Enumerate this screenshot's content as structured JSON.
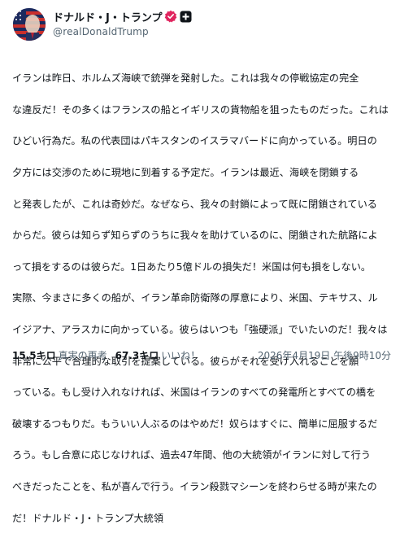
{
  "author": {
    "display_name": "ドナルド・J・トランプ",
    "handle": "@realDonaldTrump",
    "avatar": "flag-portrait-avatar",
    "verified_icon": "verified-badge-icon",
    "affiliate_icon": "plus-square-badge-icon",
    "verified_color": "#e0245e"
  },
  "post": {
    "lines": [
      "イランは昨日、ホルムズ海峡で銃弾を発射した。これは我々の停戦協定の完全",
      "な違反だ！その多くはフランスの船とイギリスの貨物船を狙ったものだった。これは",
      "ひどい行為だ。私の代表団はパキスタンのイスラマバードに向かっている。明日の",
      "夕方には交渉のために現地に到着する予定だ。イランは最近、海峡を閉鎖する",
      "と発表したが、これは奇妙だ。なぜなら、我々の封鎖によって既に閉鎖されている",
      "からだ。彼らは知らず知らずのうちに我々を助けているのに、閉鎖された航路によ",
      "って損をするのは彼らだ。1日あたり5億ドルの損失だ！米国は何も損をしない。",
      "実際、今まさに多くの船が、イラン革命防衛隊の厚意により、米国、テキサス、ル",
      "イジアナ、アラスカに向かっている。彼らはいつも「強硬派」でいたいのだ！我々は",
      "非常に公平で合理的な取引を提案している。彼らがそれを受け入れることを願",
      "っている。もし受け入れなければ、米国はイランのすべての発電所とすべての橋を",
      "破壊するつもりだ。もういい人ぶるのはやめだ！奴らはすぐに、簡単に屈服するだ",
      "ろう。もし合意に応じなければ、過去47年間、他の大統領がイランに対して行う",
      "べきだったことを、私が喜んで行う。イラン殺戮マシーンを終わらせる時が来たの",
      "だ！ドナルド・J・トランプ大統領"
    ]
  },
  "footer": {
    "restruths_count": "15.5キロ",
    "restruths_label": "真実の再考",
    "likes_count": "67.3キロ",
    "likes_label": "いいね！",
    "timestamp": "2026年4月19日 午後9時10分"
  }
}
